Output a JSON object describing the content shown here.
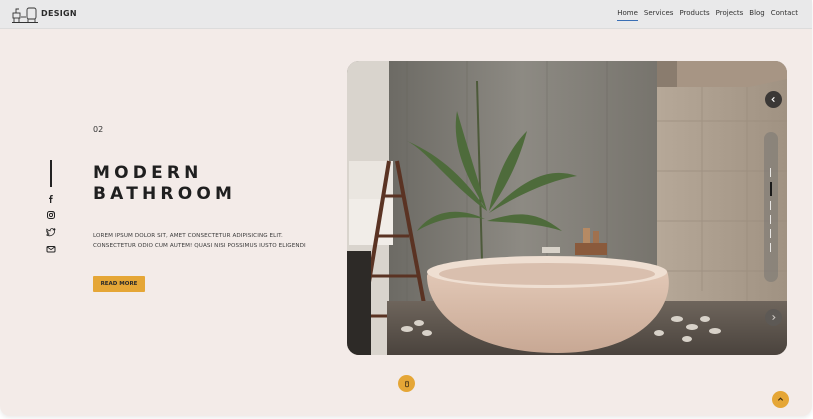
{
  "brand": {
    "name": "DESIGN",
    "logo_icon": "furniture-logo-icon"
  },
  "nav": {
    "items": [
      {
        "label": "Home",
        "active": true
      },
      {
        "label": "Services"
      },
      {
        "label": "Products"
      },
      {
        "label": "Projects"
      },
      {
        "label": "Blog"
      },
      {
        "label": "Contact"
      }
    ]
  },
  "social": {
    "icons": [
      "facebook-icon",
      "instagram-icon",
      "twitter-icon",
      "mail-icon"
    ]
  },
  "hero": {
    "slide_number": "02",
    "title_line1": "MODERN",
    "title_line2": "BATHROOM",
    "description_line1": "LOREM IPSUM DOLOR SIT, AMET CONSECTETUR ADIPISICING ELIT.",
    "description_line2": "CONSECTETUR ODIO CUM AUTEM! QUASI NISI POSSIMUS IUSTO ELIGENDI",
    "button_label": "READ MORE",
    "image_subject": "bathroom-bathtub-photo"
  },
  "slider": {
    "active_index": 2,
    "count": 6
  },
  "colors": {
    "accent": "#e5a636",
    "background": "#f3ebe8",
    "navbar": "#e9e9ea",
    "nav_active_underline": "#3a6fb5"
  }
}
